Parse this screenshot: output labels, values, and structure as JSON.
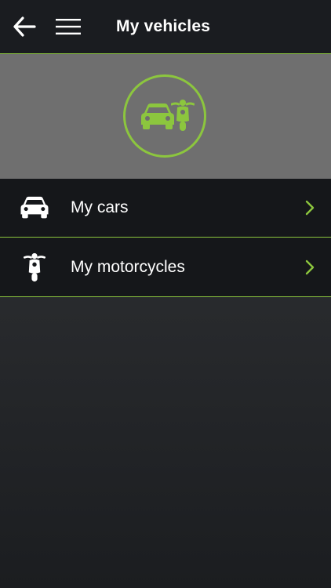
{
  "header": {
    "title": "My vehicles"
  },
  "icons": {
    "back": "arrow-left-icon",
    "menu": "hamburger-menu-icon",
    "hero": [
      "car-icon",
      "motorcycle-icon"
    ],
    "chevron": "chevron-right-icon"
  },
  "list": {
    "items": [
      {
        "label": "My cars",
        "icon": "car-icon"
      },
      {
        "label": "My motorcycles",
        "icon": "motorcycle-icon"
      }
    ]
  },
  "colors": {
    "accent": "#8cc63e",
    "header_bg": "#1a1c20",
    "hero_bg": "#6f6f6f",
    "row_bg": "#15171a",
    "text": "#ffffff"
  }
}
